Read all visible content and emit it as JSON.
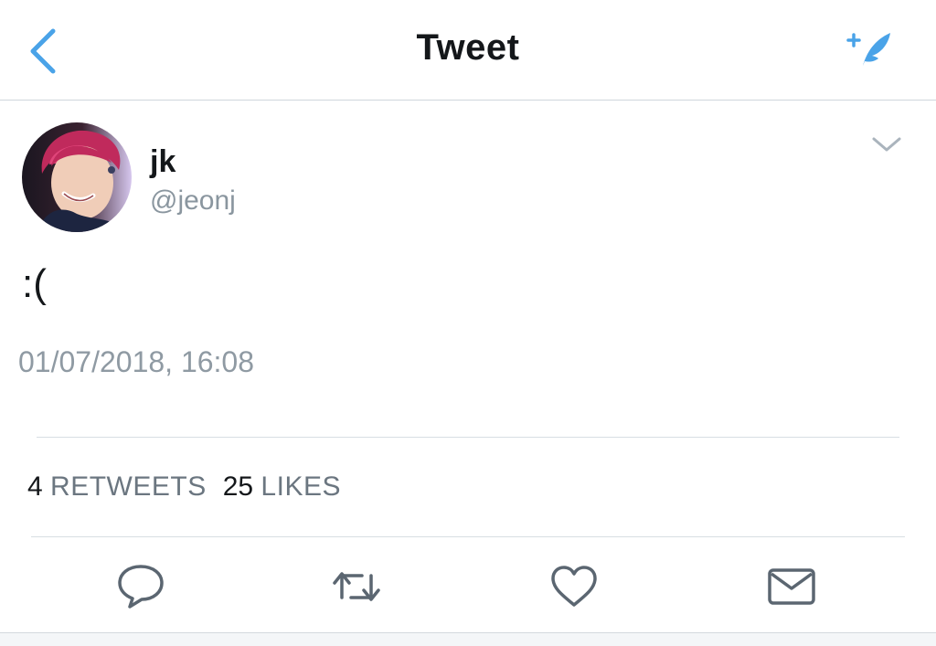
{
  "header": {
    "title": "Tweet",
    "back_icon": "chevron-left-icon",
    "compose_icon": "compose-tweet-icon",
    "accent_color": "#4aa3e8"
  },
  "tweet": {
    "user": {
      "display_name": "jk",
      "handle": "@jeonj"
    },
    "text": ":(",
    "timestamp": "01/07/2018, 16:08",
    "stats": {
      "retweets_count": "4",
      "retweets_label": "RETWEETS",
      "likes_count": "25",
      "likes_label": "LIKES"
    }
  },
  "actions": [
    {
      "icon": "reply-icon"
    },
    {
      "icon": "retweet-icon"
    },
    {
      "icon": "heart-icon"
    },
    {
      "icon": "mail-icon"
    }
  ]
}
